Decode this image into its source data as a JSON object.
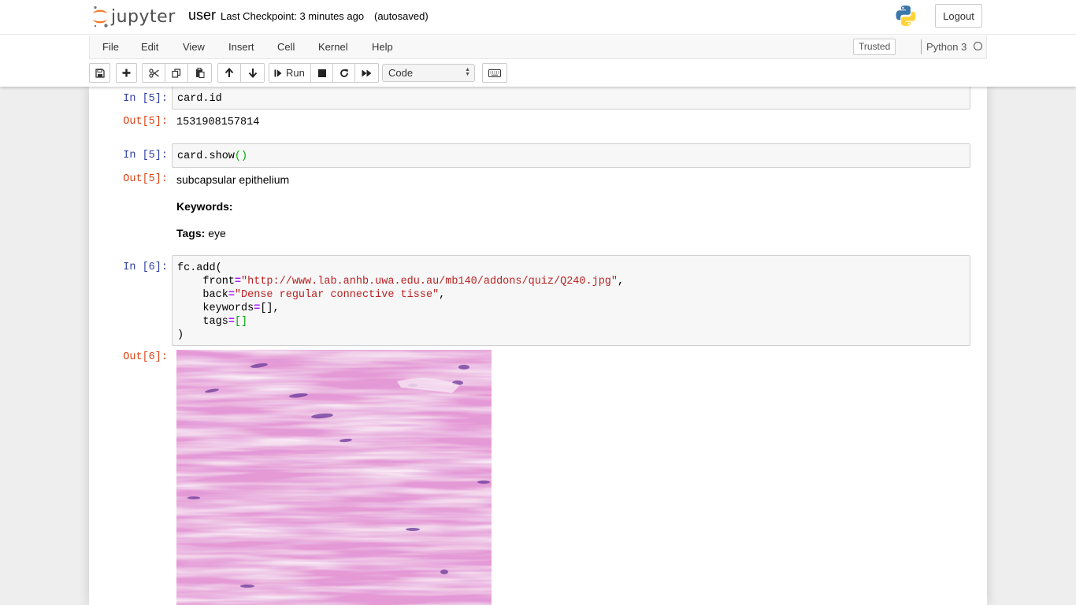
{
  "header": {
    "logo_text": "jupyter",
    "notebook_name": "user",
    "checkpoint": "Last Checkpoint: 3 minutes ago",
    "autosave": "(autosaved)",
    "logout_label": "Logout"
  },
  "menubar": {
    "items": [
      "File",
      "Edit",
      "View",
      "Insert",
      "Cell",
      "Kernel",
      "Help"
    ],
    "trusted_label": "Trusted",
    "kernel_name": "Python 3"
  },
  "toolbar": {
    "run_label": "Run",
    "cell_type": "Code",
    "icons": [
      "save-icon",
      "plus-icon",
      "cut-icon",
      "copy-icon",
      "paste-icon",
      "arrow-up-icon",
      "arrow-down-icon",
      "step-forward-icon",
      "stop-icon",
      "restart-icon",
      "fast-forward-icon",
      "keyboard-icon"
    ]
  },
  "cells": [
    {
      "in_prompt": "In [5]:",
      "code": "card.id",
      "out_prompt": "Out[5]:",
      "output": "1531908157814"
    },
    {
      "in_prompt": "In [5]:",
      "code_fn": "card.show",
      "code_parens": "()",
      "out_prompt": "Out[5]:",
      "output_title": "subcapsular epithelium",
      "keywords_label": "Keywords:",
      "tags_label": "Tags:",
      "tags_value": "eye"
    },
    {
      "in_prompt": "In [6]:",
      "line1": "fc.add(",
      "front_key": "front",
      "front_val": "\"http://www.lab.anhb.uwa.edu.au/mb140/addons/quiz/Q240.jpg\"",
      "back_key": "back",
      "back_val": "\"Dense regular connective tisse\"",
      "keywords_key": "keywords",
      "keywords_val": "[],",
      "tags_key": "tags",
      "tags_val": "[]",
      "close": ")",
      "out_prompt": "Out[6]:",
      "image_subject": "histology micrograph of dense regular connective tissue"
    }
  ],
  "colors": {
    "in_prompt": "#303f9f",
    "out_prompt": "#d84315",
    "string": "#ba2121",
    "operator": "#aa22ff",
    "bracket": "#00aa00",
    "tissue_pink": "#e59ad6",
    "nucleus": "#6a3a9a"
  }
}
